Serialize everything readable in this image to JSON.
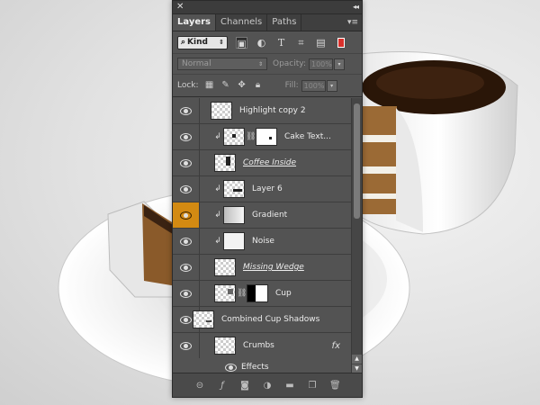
{
  "panel": {
    "close_glyph": "✕",
    "collapse_glyph": "◂◂",
    "tabs": [
      {
        "label": "Layers",
        "active": true
      },
      {
        "label": "Channels",
        "active": false
      },
      {
        "label": "Paths",
        "active": false
      }
    ],
    "menu_glyph": "▾≡"
  },
  "filter": {
    "kind_label": "Kind",
    "icons": [
      "image-filter-icon",
      "adjustment-filter-icon",
      "type-filter-icon",
      "shape-filter-icon",
      "smart-object-filter-icon"
    ],
    "toggle_color": "#d9302b"
  },
  "blend": {
    "mode": "Normal",
    "opacity_label": "Opacity:",
    "opacity_value": "100%",
    "fill_label": "Fill:",
    "fill_value": "100%",
    "lock_label": "Lock:"
  },
  "layers": [
    {
      "name": "Highlight copy 2",
      "visible": true,
      "thumb": "checker"
    },
    {
      "name": "Cake Text...",
      "visible": true,
      "clipped": true,
      "thumb": "checker",
      "mask": true
    },
    {
      "name": "Coffee Inside",
      "visible": true,
      "thumb": "checker",
      "style": "underline"
    },
    {
      "name": "Layer 6",
      "visible": true,
      "clipped": true,
      "thumb": "checker"
    },
    {
      "name": "Gradient",
      "visible": true,
      "clipped": true,
      "thumb": "gradient",
      "highlighted": true
    },
    {
      "name": "Noise",
      "visible": true,
      "clipped": true,
      "thumb": "solid"
    },
    {
      "name": "Missing Wedge",
      "visible": true,
      "thumb": "checker",
      "style": "underline"
    },
    {
      "name": "Cup",
      "visible": true,
      "thumb": "checker",
      "mask": "dark"
    },
    {
      "name": "Combined Cup Shadows",
      "visible": true,
      "thumb": "checker"
    },
    {
      "name": "Crumbs",
      "visible": true,
      "thumb": "checker",
      "fx": "fx"
    }
  ],
  "effects_label": "Effects",
  "highlight_color": "#d38a12",
  "footer_icons": [
    "link-layers-icon",
    "fx-icon",
    "mask-icon",
    "adjustment-icon",
    "folder-icon",
    "new-layer-icon",
    "trash-icon"
  ]
}
